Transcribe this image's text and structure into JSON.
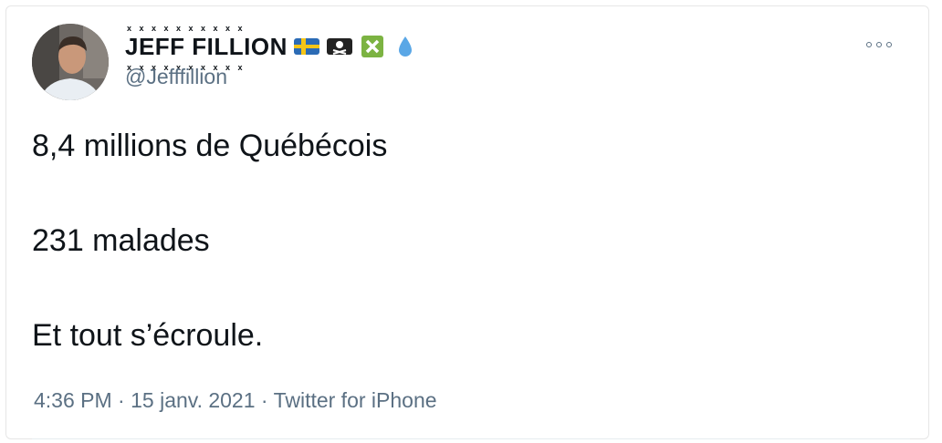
{
  "tweet": {
    "author": {
      "display_name": "JEFF FILLION",
      "handle": "@Jefffillion",
      "badges": [
        "sweden-flag-icon",
        "pirate-flag-icon",
        "cross-mark-icon",
        "droplet-icon"
      ]
    },
    "lines": [
      "8,4 millions de Québécois",
      "231 malades",
      "Et tout s’écroule."
    ],
    "time": "4:36 PM",
    "date": "15 janv. 2021",
    "source": "Twitter for iPhone",
    "separator": "·"
  },
  "colors": {
    "text": "#0f1419",
    "secondary": "#5b7083",
    "border": "#e6e6e6"
  }
}
